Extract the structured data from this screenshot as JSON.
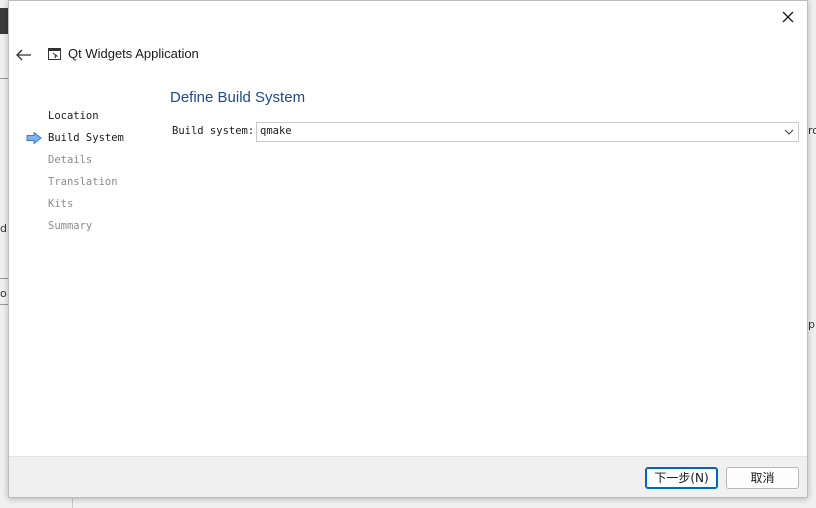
{
  "window": {
    "title": "Qt Widgets Application"
  },
  "steps": [
    {
      "label": "Location",
      "state": "done"
    },
    {
      "label": "Build System",
      "state": "current"
    },
    {
      "label": "Details",
      "state": "pending"
    },
    {
      "label": "Translation",
      "state": "pending"
    },
    {
      "label": "Kits",
      "state": "pending"
    },
    {
      "label": "Summary",
      "state": "pending"
    }
  ],
  "page": {
    "title": "Define Build System",
    "build_system_label": "Build system:",
    "build_system_value": "qmake"
  },
  "buttons": {
    "next": "下一步(N)",
    "cancel": "取消"
  },
  "background": {
    "edge_text_1": "ro",
    "edge_text_2": "p.",
    "edge_text_3": "o",
    "edge_text_4": "d"
  },
  "colors": {
    "accent": "#1f4a8c",
    "focus": "#0067c0",
    "step_arrow": "#4a90e2"
  },
  "icons": {
    "close": "close-icon",
    "back": "back-arrow-icon",
    "app": "app-window-icon",
    "chevron": "chevron-down-icon",
    "step": "current-step-arrow-icon"
  }
}
